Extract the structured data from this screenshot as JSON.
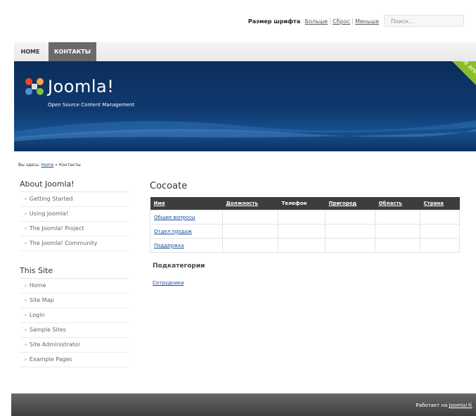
{
  "top": {
    "font_size_label": "Размер шрифта",
    "bigger": "Больше",
    "reset": "Сброс",
    "smaller": "Меньше",
    "search_placeholder": "Поиск..."
  },
  "nav": {
    "items": [
      {
        "label": "HOME"
      },
      {
        "label": "КОНТАКТЫ"
      }
    ]
  },
  "banner": {
    "logo": "Joomla!",
    "tagline": "Open Source Content Management",
    "ribbon": "We are volunteers !"
  },
  "breadcrumb": {
    "prefix": "Вы здесь:",
    "home": "Home",
    "separator": "»",
    "current": "Контакты"
  },
  "sidebar": {
    "about_title": "About Joomla!",
    "about_items": [
      "Getting Started",
      "Using Joomla!",
      "The Joomla! Project",
      "The Joomla! Community"
    ],
    "site_title": "This Site",
    "site_items": [
      "Home",
      "Site Map",
      "Login",
      "Sample Sites",
      "Site Administrator",
      "Example Pages"
    ]
  },
  "main": {
    "title": "Cocoate",
    "headers": [
      "Имя",
      "Должность",
      "Телефон",
      "Пригород",
      "Область",
      "Страна"
    ],
    "rows": [
      "Общие вопросы",
      "Отдел продаж",
      "Поддержка"
    ],
    "subcategories_title": "Подкатегории",
    "subcategory_link": "Сотрудники"
  },
  "footer": {
    "text": "Работает на",
    "link": "Joomla!®"
  },
  "colors": {
    "banner": "#0f3a70",
    "ribbon": "#8bbd2a",
    "active_tab": "#6a6a6a",
    "footer": "#4f4f4f"
  }
}
